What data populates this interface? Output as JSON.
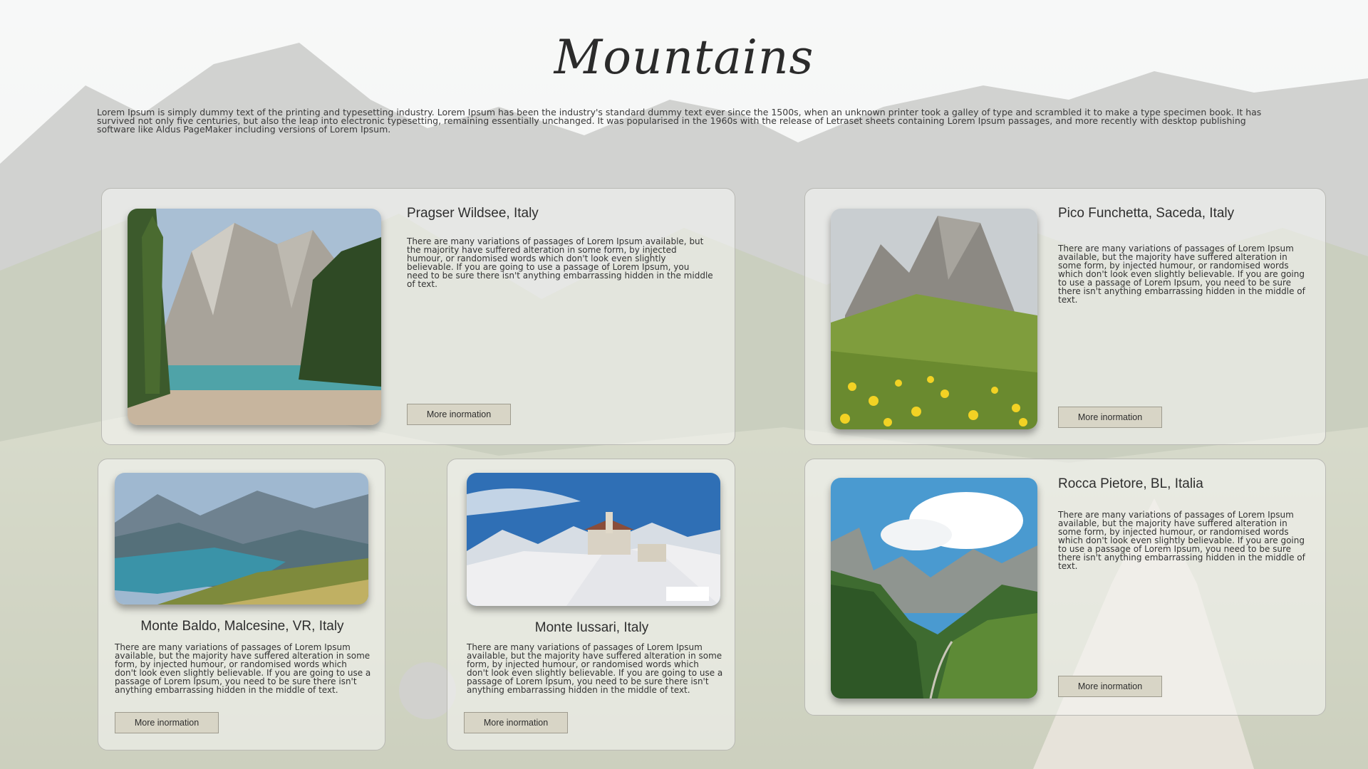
{
  "page": {
    "title": "Mountains",
    "intro": " Lorem Ipsum is simply dummy text of the printing and typesetting industry. Lorem Ipsum has been the industry's standard dummy text ever since the 1500s, when an unknown printer took a galley of type and scrambled it to make a type specimen book. It has survived not only five centuries, but also the leap into electronic typesetting, remaining essentially unchanged. It was popularised in the 1960s with the release of Letraset sheets containing Lorem Ipsum passages, and more recently with desktop publishing software like Aldus PageMaker including versions of Lorem Ipsum."
  },
  "colors": {
    "button_bg": "#d8d5c6",
    "button_border": "#9e9b8e",
    "card_border": "#b9b9b4",
    "title_text": "#2b2b2b"
  },
  "cards": [
    {
      "title": "Pragser Wildsee, Italy",
      "text": " There are many variations of passages of Lorem Ipsum available, but the majority have suffered alteration in some form, by injected humour, or randomised words which don't look even slightly believable. If you are going to use a passage of Lorem Ipsum, you need to be sure there isn't anything embarrassing hidden in the middle of text.",
      "button": "More inormation",
      "image": "lake-with-mountain-photo"
    },
    {
      "title": "Pico Funchetta, Saceda, Italy",
      "text": " There are many variations of passages of Lorem Ipsum available, but the majority have suffered alteration in some form, by injected humour, or randomised words which don't look even slightly believable. If you are going to use a passage of Lorem Ipsum, you need to be sure there isn't anything embarrassing hidden in the middle of text.",
      "button": "More inormation",
      "image": "peaks-with-flowers-photo"
    },
    {
      "title": "Monte Baldo, Malcesine, VR, Italy",
      "text": " There are many variations of passages of Lorem Ipsum available, but the majority have suffered alteration in some form, by injected humour, or randomised words which don't look even slightly believable. If you are going to use a passage of Lorem Ipsum, you need to be sure there isn't anything embarrassing hidden in the middle of text.",
      "button": "More inormation",
      "image": "lake-valley-photo"
    },
    {
      "title": "Monte Iussari, Italy",
      "text": " There are many variations of passages of Lorem Ipsum available, but the majority have suffered alteration in some form, by injected humour, or randomised words which don't look even slightly believable. If you are going to use a passage of Lorem Ipsum, you need to be sure there isn't anything embarrassing hidden in the middle of text.",
      "button": "More inormation",
      "image": "snowy-village-photo"
    },
    {
      "title": "Rocca Pietore, BL, Italia",
      "text": " There are many variations of passages of Lorem Ipsum available, but the majority have suffered alteration in some form, by injected humour, or randomised words which don't look even slightly believable. If you are going to use a passage of Lorem Ipsum, you need to be sure there isn't anything embarrassing hidden in the middle of text.",
      "button": "More inormation",
      "image": "green-valley-photo"
    }
  ]
}
